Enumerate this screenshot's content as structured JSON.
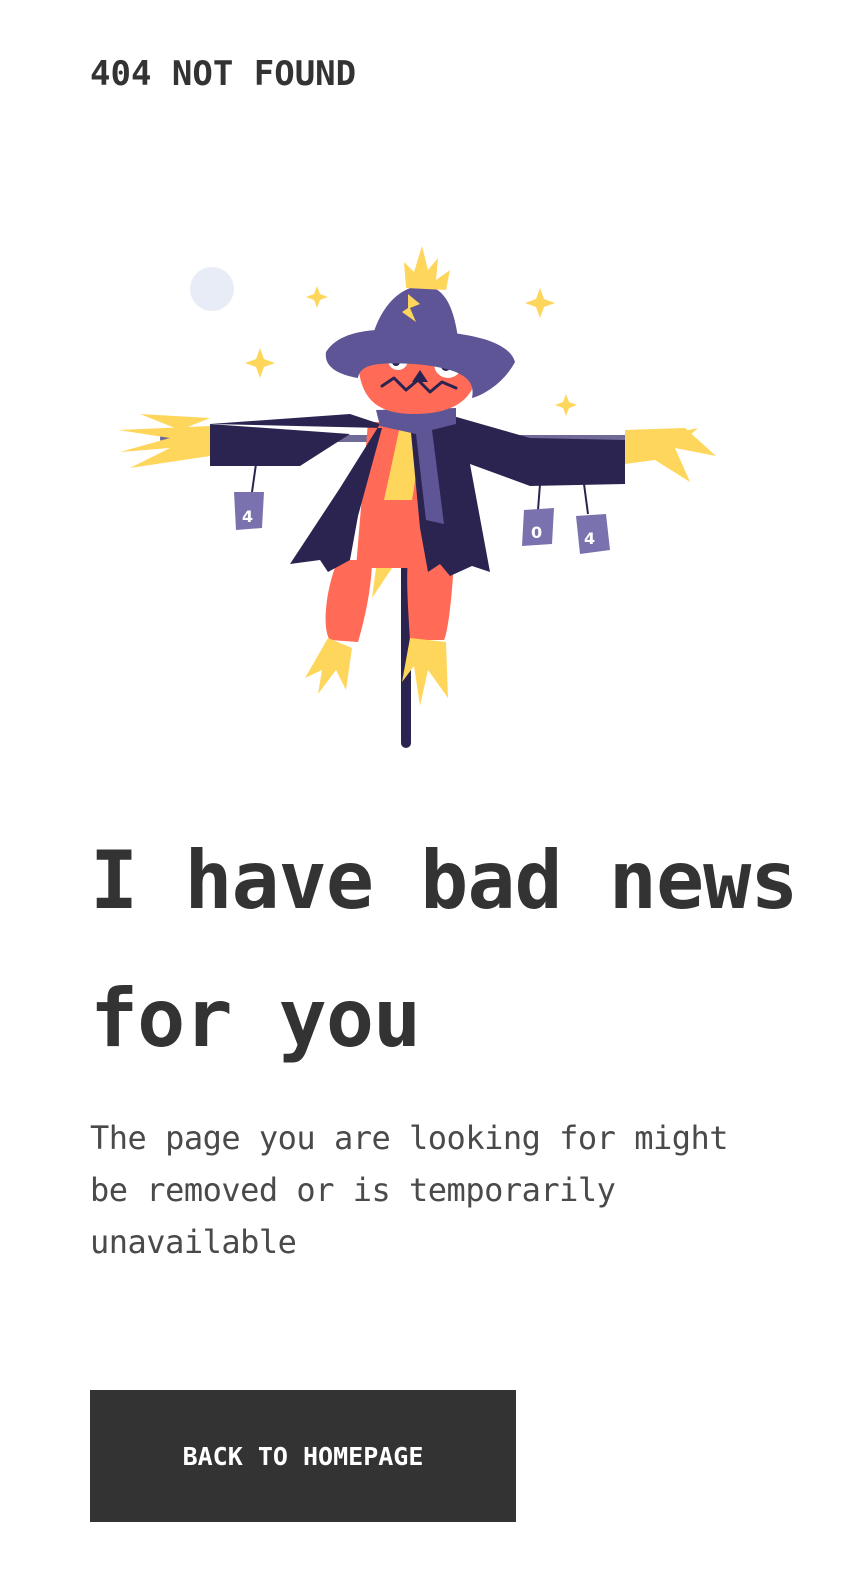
{
  "header": {
    "title": "404 NOT FOUND"
  },
  "illustration": {
    "subject": "scarecrow",
    "can_labels": [
      "4",
      "0",
      "4"
    ]
  },
  "main": {
    "headline": "I have bad news for you",
    "description": "The page you are looking for might be removed or is temporarily unavailable",
    "cta_label": "BACK TO HOMEPAGE"
  },
  "colors": {
    "text": "#333333",
    "button_bg": "#333333",
    "button_text": "#ffffff",
    "straw": "#FFD65C",
    "pumpkin": "#FF6B57",
    "coat": "#2B2450",
    "hat": "#5E5596",
    "moon": "#E8ECF6"
  }
}
